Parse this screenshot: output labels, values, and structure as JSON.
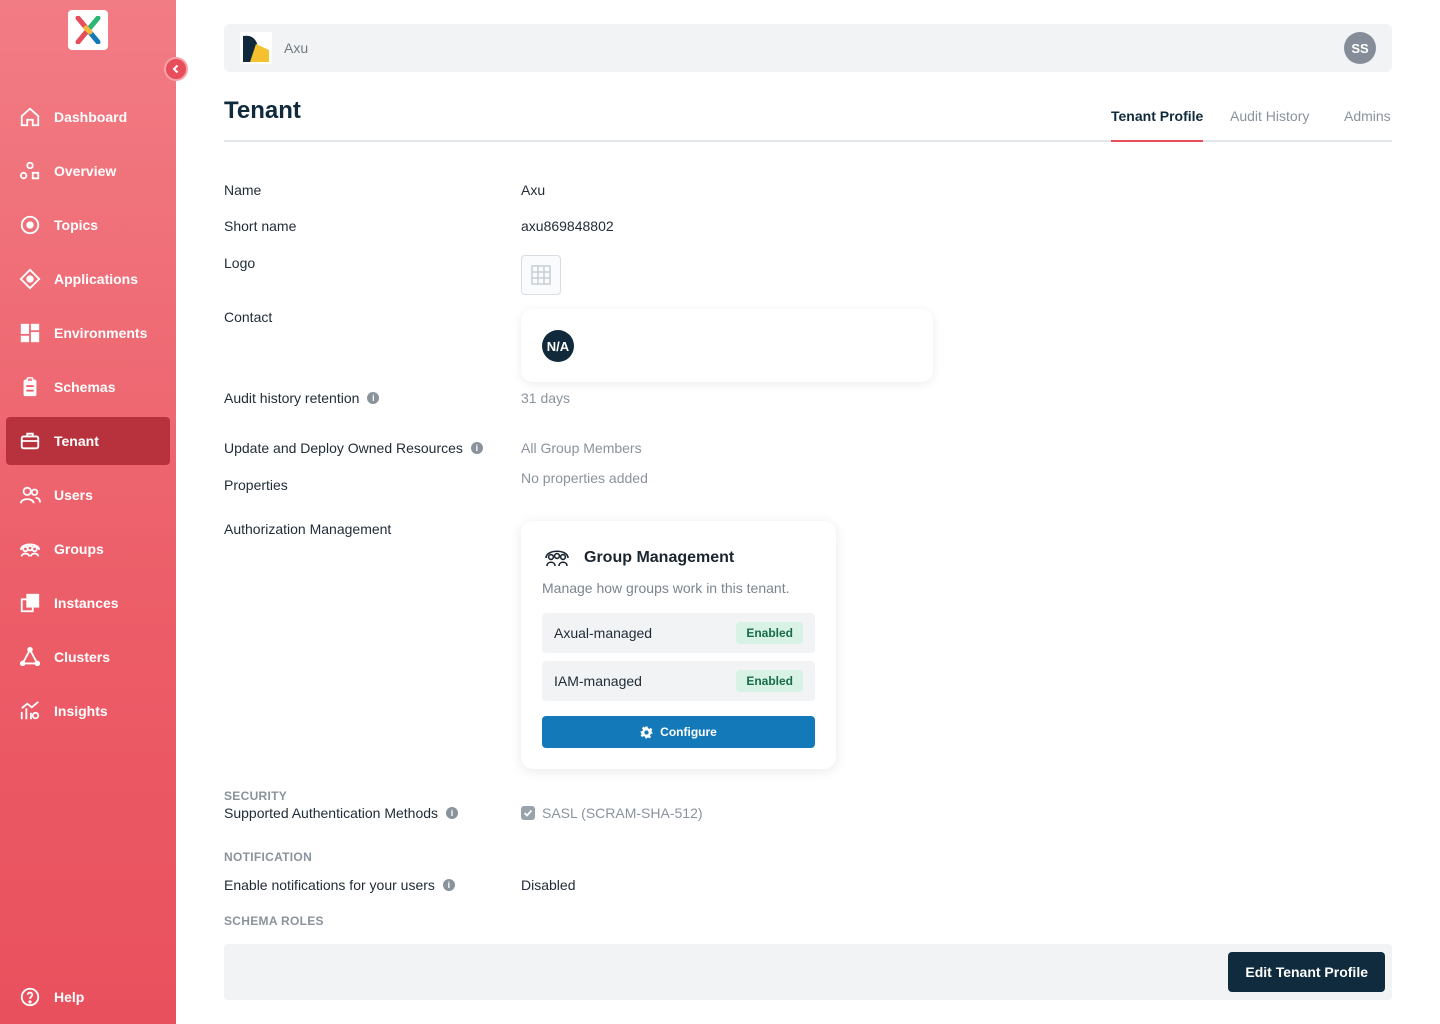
{
  "sidebar": {
    "collapse_icon": "chevron-left-icon",
    "items": [
      {
        "label": "Dashboard",
        "icon": "home-icon"
      },
      {
        "label": "Overview",
        "icon": "overview-icon"
      },
      {
        "label": "Topics",
        "icon": "topic-icon"
      },
      {
        "label": "Applications",
        "icon": "application-icon"
      },
      {
        "label": "Environments",
        "icon": "grid-icon"
      },
      {
        "label": "Schemas",
        "icon": "clipboard-icon"
      },
      {
        "label": "Tenant",
        "icon": "briefcase-icon",
        "active": true
      },
      {
        "label": "Users",
        "icon": "users-icon"
      },
      {
        "label": "Groups",
        "icon": "groups-icon"
      },
      {
        "label": "Instances",
        "icon": "instances-icon"
      },
      {
        "label": "Clusters",
        "icon": "cluster-icon"
      },
      {
        "label": "Insights",
        "icon": "insights-icon"
      }
    ],
    "help_label": "Help"
  },
  "topbar": {
    "tenant_name": "Axu",
    "user_initials": "SS"
  },
  "header": {
    "title": "Tenant",
    "tabs": [
      {
        "label": "Tenant Profile",
        "active": true
      },
      {
        "label": "Audit History"
      },
      {
        "label": "Admins"
      }
    ]
  },
  "profile": {
    "name_label": "Name",
    "name_value": "Axu",
    "short_name_label": "Short name",
    "short_name_value": "axu869848802",
    "logo_label": "Logo",
    "contact_label": "Contact",
    "contact_initials": "N/A",
    "audit_label": "Audit history retention",
    "audit_value": "31 days",
    "deploy_label": "Update and Deploy Owned Resources",
    "deploy_value": "All Group Members",
    "properties_label": "Properties",
    "properties_value": "No properties added",
    "authz_label": "Authorization Management"
  },
  "group_management": {
    "title": "Group Management",
    "description": "Manage how groups work in this tenant.",
    "rows": [
      {
        "label": "Axual-managed",
        "status": "Enabled"
      },
      {
        "label": "IAM-managed",
        "status": "Enabled"
      }
    ],
    "configure_label": "Configure"
  },
  "security": {
    "heading": "SECURITY",
    "auth_label": "Supported Authentication Methods",
    "auth_value": "SASL (SCRAM-SHA-512)"
  },
  "notification": {
    "heading": "NOTIFICATION",
    "label": "Enable notifications for your users",
    "value": "Disabled"
  },
  "schema_roles": {
    "heading": "SCHEMA ROLES"
  },
  "footer": {
    "edit_label": "Edit Tenant Profile"
  },
  "colors": {
    "sidebar_gradient_top": "#f27c84",
    "sidebar_gradient_bottom": "#e9505d",
    "active_nav": "#b8323d",
    "accent": "#e84d5b",
    "primary_button": "#1479b8",
    "dark_button": "#0f2b3d",
    "badge_bg": "#d9f2e6",
    "badge_text": "#176c47"
  }
}
